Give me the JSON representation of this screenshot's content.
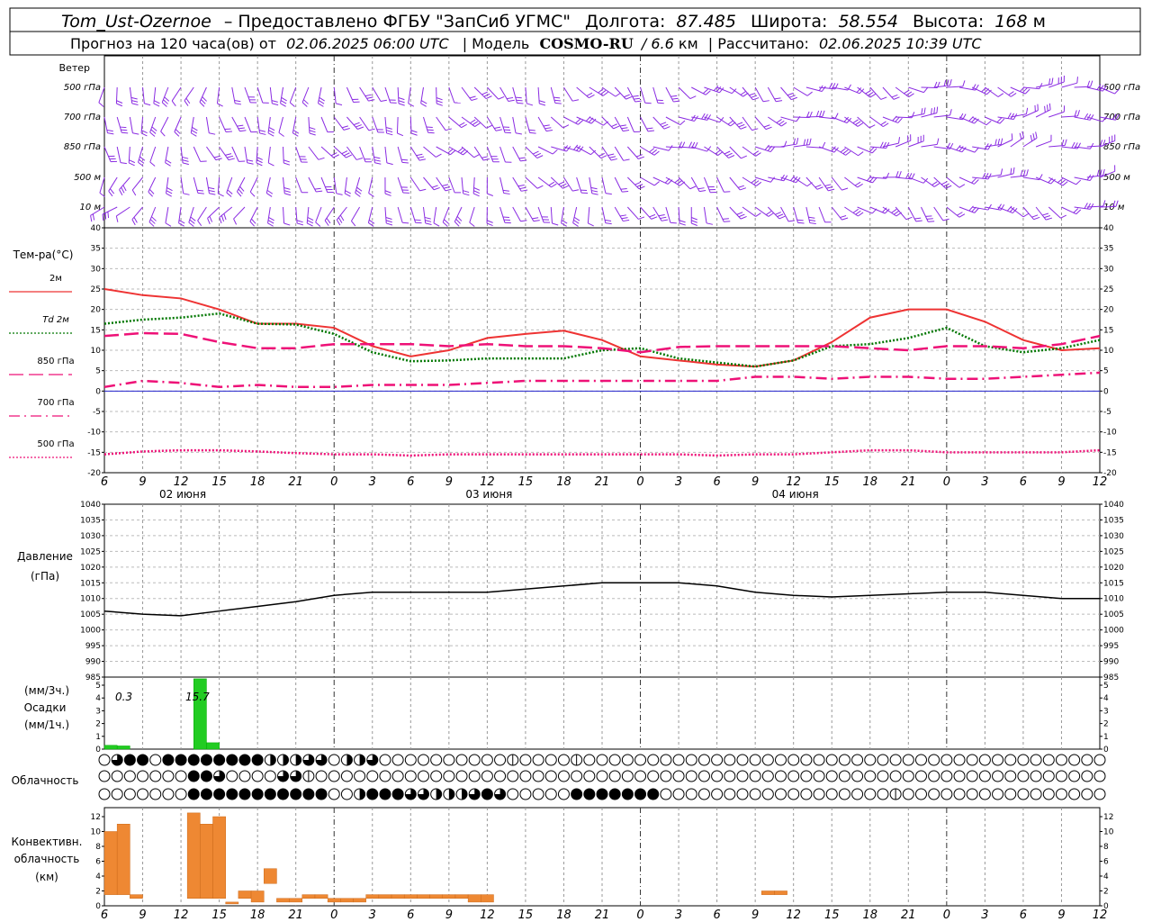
{
  "header": {
    "line1": {
      "station": "Tom_Ust-Ozernoe",
      "provider": "– Предоставлено ФГБУ \"ЗапСиб УГМС\"",
      "lon_label": "Долгота:",
      "lon_value": "87.485",
      "lat_label": "Широта:",
      "lat_value": "58.554",
      "alt_label": "Высота:",
      "alt_value": "168",
      "alt_unit": "м"
    },
    "line2": {
      "forecast_label": "Прогноз на 120 часа(ов) от",
      "forecast_start": "02.06.2025 06:00 UTC",
      "model_label": "| Модель",
      "model_name": "COSMO-RU",
      "model_res": "/ 6.6",
      "model_res_unit": "км",
      "computed_label": "| Рассчитано:",
      "computed_at": "02.06.2025 10:39 UTC"
    }
  },
  "colors": {
    "wind": "#8a2be2",
    "t2m": "#ee3333",
    "td2m": "#007700",
    "t850": "#ee1177",
    "t700": "#ee1177",
    "t500": "#ee1177",
    "pressure": "#000000",
    "precip": "#22cc22",
    "conv": "#ee8833",
    "grid": "#999999",
    "zero": "#2222cc"
  },
  "time_axis": {
    "hour_labels": [
      "6",
      "9",
      "12",
      "15",
      "18",
      "21",
      "0",
      "3",
      "6",
      "9",
      "12",
      "15",
      "18",
      "21",
      "0",
      "3",
      "6",
      "9",
      "12",
      "15",
      "18",
      "21",
      "0",
      "3",
      "6",
      "9",
      "12"
    ],
    "date_labels": [
      "02 июня",
      "03 июня",
      "04 июня"
    ]
  },
  "wind_panel": {
    "title": "Ветер",
    "levels": [
      "500 гПа",
      "700 гПа",
      "850 гПа",
      "500 м",
      "10 м"
    ]
  },
  "temperature_panel": {
    "title": "Тем-ра(°C)",
    "legend": [
      {
        "label": "2м",
        "style": "solid"
      },
      {
        "label": "Td  2м",
        "style": "dotted"
      },
      {
        "label": "850 гПа",
        "style": "solid-pink"
      },
      {
        "label": "700 гПа",
        "style": "dashdot"
      },
      {
        "label": "500 гПа",
        "style": "dashed"
      }
    ],
    "yticks": [
      "40",
      "35",
      "30",
      "25",
      "20",
      "15",
      "10",
      "5",
      "0",
      "-5",
      "-10",
      "-15",
      "-20"
    ]
  },
  "pressure_panel": {
    "title": "Давление",
    "unit": "(гПа)",
    "yticks": [
      "1040",
      "1035",
      "1030",
      "1025",
      "1020",
      "1015",
      "1010",
      "1005",
      "1000",
      "995",
      "990",
      "985"
    ]
  },
  "precip_panel": {
    "unit_top": "(мм/3ч.)",
    "title": "Осадки",
    "unit_bottom": "(мм/1ч.)",
    "yticks": [
      "5",
      "4",
      "3",
      "2",
      "1",
      "0"
    ],
    "annotations": [
      "0.3",
      "15.7"
    ]
  },
  "cloud_panel": {
    "title": "Облачность"
  },
  "conv_panel": {
    "title_lines": [
      "Конвективн.",
      "облачность",
      "(км)"
    ],
    "yticks": [
      "12",
      "10",
      "8",
      "6",
      "4",
      "2",
      "0"
    ]
  },
  "chart_data": {
    "type": "line",
    "x_unit": "forecast hour from 02.06.2025 06:00 UTC",
    "temperature": {
      "ylim": [
        -20,
        40
      ],
      "series": [
        {
          "name": "2м",
          "x": [
            0,
            3,
            6,
            9,
            12,
            15,
            18,
            21,
            24,
            27,
            30,
            33,
            36,
            39,
            42,
            45,
            48,
            51,
            54,
            57,
            60,
            63,
            66,
            69,
            72,
            75,
            78
          ],
          "values": [
            25,
            23.5,
            22.7,
            20,
            16.5,
            16.5,
            15.5,
            11,
            8.5,
            10,
            13,
            14,
            14.8,
            12.5,
            8.5,
            7.5,
            6.5,
            6,
            7.5,
            12,
            18,
            20,
            20,
            17,
            12.5,
            10,
            10.5
          ]
        },
        {
          "name": "Td  2м",
          "x": [
            0,
            3,
            6,
            9,
            12,
            15,
            18,
            21,
            24,
            27,
            30,
            33,
            36,
            39,
            42,
            45,
            48,
            51,
            54,
            57,
            60,
            63,
            66,
            69,
            72,
            75,
            78
          ],
          "values": [
            16.5,
            17.5,
            18,
            19,
            16.5,
            16.3,
            14,
            9.5,
            7.3,
            7.5,
            8,
            8,
            8,
            10,
            10.5,
            8,
            7,
            6,
            7.5,
            11,
            11.5,
            13,
            15.5,
            11,
            9.5,
            10.5,
            12.5
          ]
        },
        {
          "name": "850 гПа",
          "x": [
            0,
            3,
            6,
            9,
            12,
            15,
            18,
            21,
            24,
            27,
            30,
            33,
            36,
            39,
            42,
            45,
            48,
            51,
            54,
            57,
            60,
            63,
            66,
            69,
            72,
            75,
            78
          ],
          "values": [
            13.5,
            14.2,
            14,
            12,
            10.5,
            10.5,
            11.5,
            11.5,
            11.5,
            11,
            11.5,
            11,
            11,
            10.5,
            9.5,
            10.8,
            11,
            11,
            11,
            11,
            10.5,
            10,
            11,
            11,
            10.5,
            11.5,
            13.5
          ]
        },
        {
          "name": "700 гПа",
          "x": [
            0,
            3,
            6,
            9,
            12,
            15,
            18,
            21,
            24,
            27,
            30,
            33,
            36,
            39,
            42,
            45,
            48,
            51,
            54,
            57,
            60,
            63,
            66,
            69,
            72,
            75,
            78
          ],
          "values": [
            1,
            2.5,
            2,
            1,
            1.5,
            1,
            1,
            1.5,
            1.5,
            1.5,
            2,
            2.5,
            2.5,
            2.5,
            2.5,
            2.5,
            2.5,
            3.5,
            3.5,
            3,
            3.5,
            3.5,
            3,
            3,
            3.5,
            4,
            4.5
          ]
        },
        {
          "name": "500 гПа",
          "x": [
            0,
            3,
            6,
            9,
            12,
            15,
            18,
            21,
            24,
            27,
            30,
            33,
            36,
            39,
            42,
            45,
            48,
            51,
            54,
            57,
            60,
            63,
            66,
            69,
            72,
            75,
            78
          ],
          "values": [
            -15.5,
            -14.8,
            -14.5,
            -14.5,
            -14.8,
            -15.2,
            -15.5,
            -15.5,
            -15.8,
            -15.5,
            -15.5,
            -15.5,
            -15.5,
            -15.5,
            -15.5,
            -15.5,
            -15.8,
            -15.5,
            -15.5,
            -15,
            -14.5,
            -14.5,
            -15,
            -15,
            -15,
            -15,
            -14.5
          ]
        }
      ]
    },
    "pressure": {
      "ylim": [
        985,
        1040
      ],
      "x": [
        0,
        3,
        6,
        9,
        12,
        15,
        18,
        21,
        24,
        27,
        30,
        33,
        36,
        39,
        42,
        45,
        48,
        51,
        54,
        57,
        60,
        63,
        66,
        69,
        72,
        75,
        78
      ],
      "values": [
        1006,
        1005,
        1004.5,
        1006,
        1007.5,
        1009,
        1011,
        1012,
        1012,
        1012,
        1012,
        1013,
        1014,
        1015,
        1015,
        1015,
        1014,
        1012,
        1011,
        1010.5,
        1011,
        1011.5,
        1012,
        1012,
        1011,
        1010,
        1010
      ]
    },
    "precipitation": {
      "ylim": [
        0,
        5
      ],
      "bars": [
        {
          "x": 0,
          "value": 0.3
        },
        {
          "x": 1,
          "value": 0.25
        },
        {
          "x": 7,
          "value": 5.5
        },
        {
          "x": 8,
          "value": 0.5
        }
      ]
    },
    "convective_cloud": {
      "ylim": [
        0,
        13
      ],
      "bars": [
        {
          "x": 0.5,
          "base": 1.5,
          "top": 10
        },
        {
          "x": 1.5,
          "base": 1.5,
          "top": 11
        },
        {
          "x": 2.5,
          "base": 1,
          "top": 1.5
        },
        {
          "x": 7,
          "base": 1,
          "top": 12.5
        },
        {
          "x": 8,
          "base": 1,
          "top": 11
        },
        {
          "x": 9,
          "base": 1,
          "top": 12
        },
        {
          "x": 10,
          "base": 0.5,
          "top": 0.5
        },
        {
          "x": 11,
          "base": 1,
          "top": 2
        },
        {
          "x": 12,
          "base": 0.5,
          "top": 2
        },
        {
          "x": 13,
          "base": 3,
          "top": 5
        },
        {
          "x": 14,
          "base": 0.5,
          "top": 1
        },
        {
          "x": 15,
          "base": 0.5,
          "top": 1
        },
        {
          "x": 16,
          "base": 1,
          "top": 1.5
        },
        {
          "x": 17,
          "base": 1,
          "top": 1.5
        },
        {
          "x": 18,
          "base": 0.5,
          "top": 1
        },
        {
          "x": 19,
          "base": 0.5,
          "top": 1
        },
        {
          "x": 20,
          "base": 0.5,
          "top": 1
        },
        {
          "x": 21,
          "base": 1,
          "top": 1.5
        },
        {
          "x": 22,
          "base": 1,
          "top": 1.5
        },
        {
          "x": 23,
          "base": 1,
          "top": 1.5
        },
        {
          "x": 24,
          "base": 1,
          "top": 1.5
        },
        {
          "x": 25,
          "base": 1,
          "top": 1.5
        },
        {
          "x": 26,
          "base": 1,
          "top": 1.5
        },
        {
          "x": 27,
          "base": 1,
          "top": 1.5
        },
        {
          "x": 28,
          "base": 1,
          "top": 1.5
        },
        {
          "x": 29,
          "base": 0.5,
          "top": 1.5
        },
        {
          "x": 30,
          "base": 0.5,
          "top": 1.5
        },
        {
          "x": 52,
          "base": 1.5,
          "top": 2
        },
        {
          "x": 53,
          "base": 1.5,
          "top": 2
        }
      ]
    },
    "cloud_cover": {
      "rows": 3,
      "columns": 79,
      "levels": [
        [
          0,
          3,
          4,
          4,
          0,
          4,
          4,
          4,
          4,
          4,
          4,
          4,
          4,
          2,
          2,
          2,
          3,
          3,
          0,
          2,
          2,
          3,
          0,
          0,
          0,
          0,
          0,
          0,
          0,
          0,
          0,
          0,
          1,
          0,
          0,
          0,
          0,
          1,
          0,
          0,
          0,
          0,
          0,
          0,
          0,
          0,
          0,
          0,
          0,
          0,
          0,
          0,
          0,
          0,
          0,
          0,
          0,
          0,
          0,
          0,
          0,
          0,
          0,
          0,
          0,
          0,
          0,
          0,
          0,
          0,
          0,
          0,
          0,
          0,
          0,
          0,
          0,
          0,
          0
        ],
        [
          0,
          0,
          0,
          0,
          0,
          0,
          0,
          4,
          4,
          3,
          0,
          0,
          0,
          0,
          3,
          3,
          1,
          0,
          0,
          0,
          0,
          0,
          0,
          0,
          0,
          0,
          0,
          0,
          0,
          0,
          0,
          0,
          0,
          0,
          0,
          0,
          0,
          0,
          0,
          0,
          0,
          0,
          0,
          0,
          0,
          0,
          0,
          0,
          0,
          0,
          0,
          0,
          0,
          0,
          0,
          0,
          0,
          0,
          0,
          0,
          0,
          0,
          0,
          0,
          0,
          0,
          0,
          0,
          0,
          0,
          0,
          0,
          0,
          0,
          0,
          0,
          0,
          0,
          0
        ],
        [
          0,
          0,
          0,
          0,
          0,
          0,
          0,
          4,
          4,
          4,
          4,
          4,
          4,
          4,
          4,
          4,
          4,
          4,
          0,
          0,
          2,
          4,
          4,
          4,
          3,
          3,
          2,
          2,
          2,
          3,
          4,
          3,
          0,
          0,
          0,
          0,
          0,
          4,
          4,
          4,
          4,
          4,
          4,
          4,
          0,
          0,
          0,
          0,
          0,
          0,
          0,
          0,
          0,
          0,
          0,
          0,
          0,
          0,
          0,
          0,
          0,
          0,
          1,
          0,
          0,
          0,
          0,
          0,
          0,
          0,
          0,
          0,
          0,
          0,
          0,
          0,
          0,
          0,
          0
        ]
      ]
    }
  }
}
